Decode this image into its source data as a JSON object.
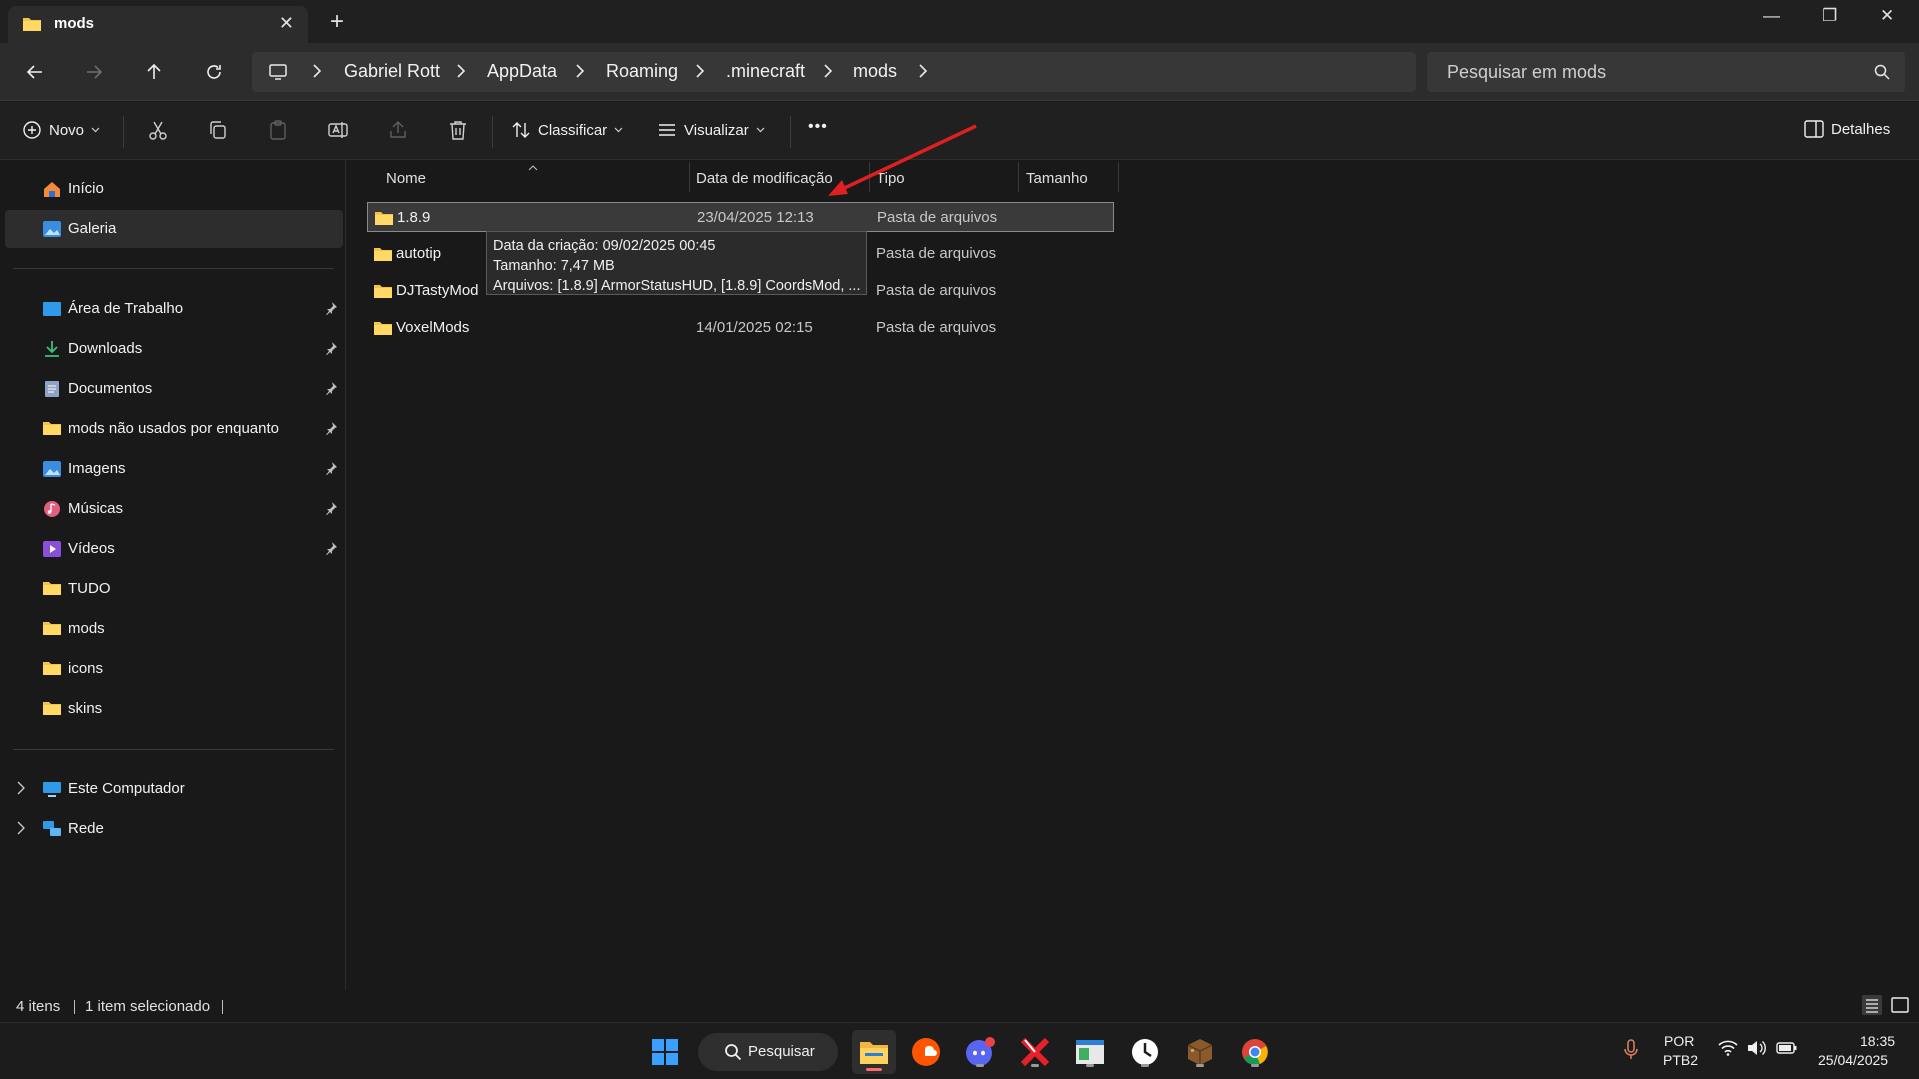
{
  "window": {
    "tab_title": "mods",
    "new_tab": "+",
    "minimize": "—",
    "restore": "❐",
    "close": "✕"
  },
  "address": {
    "crumbs": [
      "Gabriel Rott",
      "AppData",
      "Roaming",
      ".minecraft",
      "mods"
    ],
    "search_placeholder": "Pesquisar em mods"
  },
  "toolbar": {
    "new_label": "Novo",
    "sort_label": "Classificar",
    "view_label": "Visualizar",
    "more_label": "•••",
    "details_label": "Detalhes"
  },
  "sidebar": {
    "home": "Início",
    "gallery": "Galeria",
    "pinned": [
      {
        "label": "Área de Trabalho",
        "icon": "desktop-icon"
      },
      {
        "label": "Downloads",
        "icon": "download-icon"
      },
      {
        "label": "Documentos",
        "icon": "document-icon"
      },
      {
        "label": "mods não usados por enquanto",
        "icon": "folder-icon"
      },
      {
        "label": "Imagens",
        "icon": "pictures-icon"
      },
      {
        "label": "Músicas",
        "icon": "music-icon"
      },
      {
        "label": "Vídeos",
        "icon": "video-icon"
      },
      {
        "label": "TUDO",
        "icon": "folder-icon"
      },
      {
        "label": "mods",
        "icon": "folder-icon"
      },
      {
        "label": "icons",
        "icon": "folder-icon"
      },
      {
        "label": "skins",
        "icon": "folder-icon"
      }
    ],
    "this_pc": "Este Computador",
    "network": "Rede"
  },
  "columns": {
    "name": "Nome",
    "date": "Data de modificação",
    "type": "Tipo",
    "size": "Tamanho"
  },
  "files": [
    {
      "name": "1.8.9",
      "date": "23/04/2025 12:13",
      "type": "Pasta de arquivos",
      "selected": true
    },
    {
      "name": "autotip",
      "date": "",
      "type": "Pasta de arquivos",
      "selected": false
    },
    {
      "name": "DJTastyMod",
      "date": "",
      "type": "Pasta de arquivos",
      "selected": false
    },
    {
      "name": "VoxelMods",
      "date": "14/01/2025 02:15",
      "type": "Pasta de arquivos",
      "selected": false
    }
  ],
  "tooltip": {
    "created": "Data da criação: 09/02/2025 00:45",
    "size": "Tamanho: 7,47 MB",
    "files": "Arquivos: [1.8.9] ArmorStatusHUD, [1.8.9] CoordsMod, ..."
  },
  "status": {
    "count": "4 itens",
    "selected": "1 item selecionado"
  },
  "taskbar": {
    "search_label": "Pesquisar",
    "language": "POR",
    "layout": "PTB2",
    "time": "18:35",
    "date": "25/04/2025"
  },
  "colors": {
    "background": "#191919",
    "accent_folder": "#f4c542",
    "annotation_arrow": "#e02020"
  }
}
